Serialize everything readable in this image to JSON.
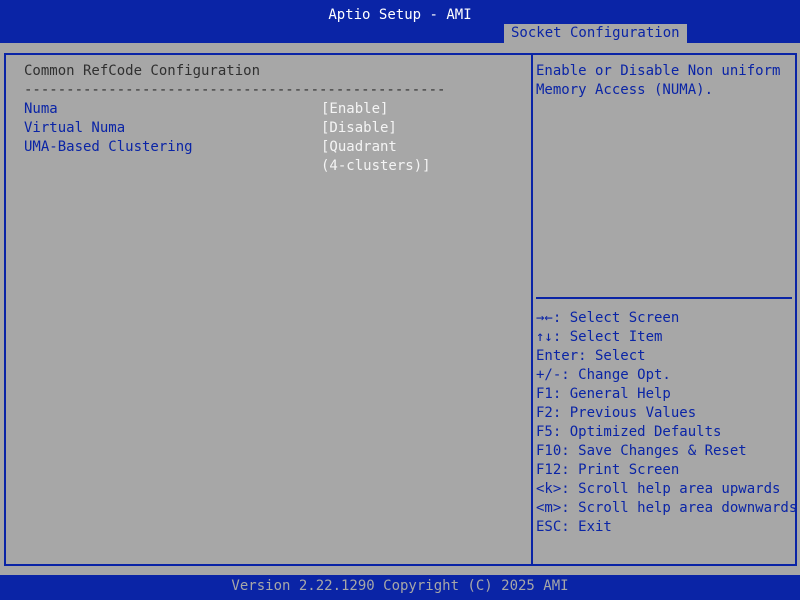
{
  "header": {
    "title": "Aptio Setup - AMI",
    "active_tab": "Socket Configuration"
  },
  "left_pane": {
    "section_title": "Common RefCode Configuration",
    "section_divider": "--------------------------------------------------",
    "items": [
      {
        "label": "Numa",
        "value": "[Enable]"
      },
      {
        "label": "Virtual Numa",
        "value": "[Disable]"
      },
      {
        "label": "UMA-Based Clustering",
        "value_lines": [
          "[Quadrant",
          "(4-clusters)]"
        ]
      }
    ]
  },
  "right_pane": {
    "help_text": "Enable or Disable Non uniform Memory Access (NUMA).",
    "key_help": [
      "→←: Select Screen",
      "↑↓: Select Item",
      "Enter: Select",
      "+/-: Change Opt.",
      "F1: General Help",
      "F2: Previous Values",
      "F5: Optimized Defaults",
      "F10: Save Changes & Reset",
      "F12: Print Screen",
      "<k>: Scroll help area upwards",
      "<m>: Scroll help area downwards",
      "ESC: Exit"
    ]
  },
  "footer": {
    "version": "Version 2.22.1290 Copyright (C) 2025 AMI"
  },
  "colors": {
    "bar_blue": "#0a24a6",
    "panel_grey": "#a7a7a7",
    "value_white": "#f4f4f4",
    "text_dark": "#303030"
  }
}
